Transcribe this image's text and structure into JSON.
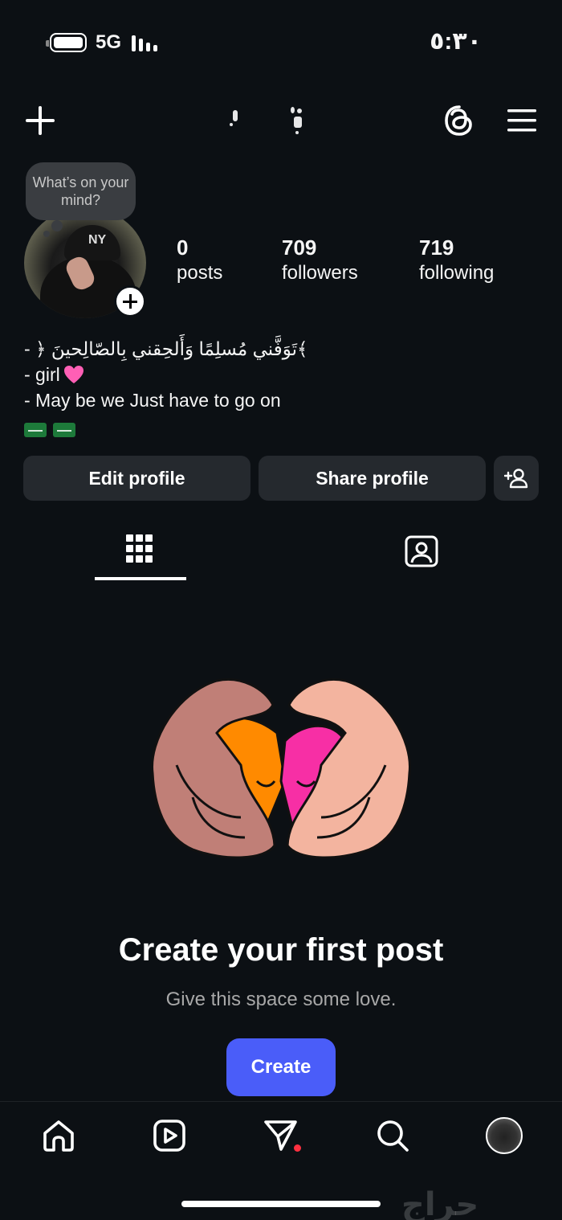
{
  "status_bar": {
    "network": "5G",
    "time": "٥:٣٠"
  },
  "profile": {
    "note_bubble": "What’s on your mind?",
    "stats": [
      {
        "value": "0",
        "label": "posts"
      },
      {
        "value": "709",
        "label": "followers"
      },
      {
        "value": "719",
        "label": "following"
      }
    ],
    "bio": {
      "line1": "- ﴿ تَوَفَّني مُسلِمًا وَأَلحِقني بِالصّالِحينَ﴾",
      "line2": "- girl",
      "line3": "- May be we Just have to go on"
    },
    "buttons": {
      "edit": "Edit profile",
      "share": "Share profile"
    }
  },
  "empty_state": {
    "title": "Create your first post",
    "subtitle": "Give this space some love.",
    "button": "Create"
  },
  "watermark": "حراج",
  "icons": {
    "header": [
      "plus-icon",
      "threads-icon",
      "menu-icon"
    ],
    "tabs": [
      "grid-icon",
      "tagged-icon"
    ],
    "nav": [
      "home-icon",
      "reels-icon",
      "direct-icon",
      "search-icon",
      "profile-avatar"
    ],
    "add_friend": "add-person-icon"
  },
  "colors": {
    "background": "#0c1014",
    "button": "#25292e",
    "accent": "#4a5df9",
    "notification": "#ff3040"
  }
}
